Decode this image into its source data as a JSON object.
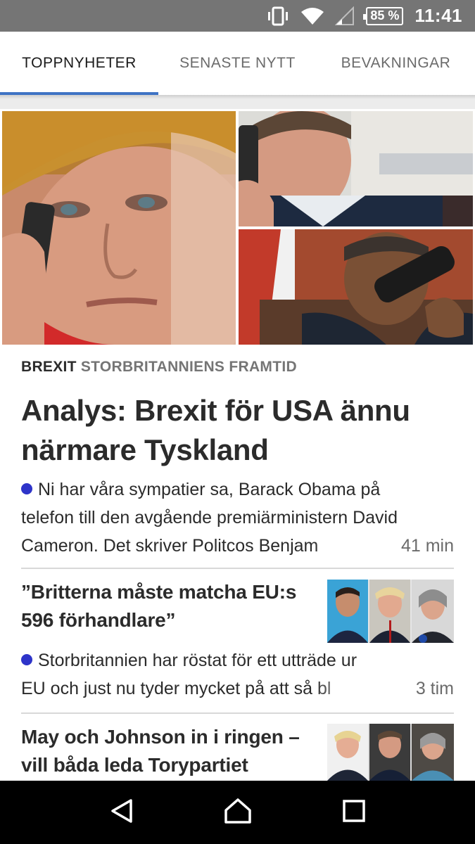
{
  "status_bar": {
    "battery": "85 %",
    "time": "11:41",
    "icons": [
      "vibrate-icon",
      "wifi-icon",
      "signal-icon",
      "battery-icon"
    ]
  },
  "tabs": [
    {
      "label": "TOPPNYHETER",
      "active": true
    },
    {
      "label": "SENASTE NYTT",
      "active": false
    },
    {
      "label": "BEVAKNINGAR",
      "active": false
    }
  ],
  "lead_story": {
    "kicker_primary": "BREXIT",
    "kicker_secondary": "STORBRITANNIENS FRAMTID",
    "headline": "Analys: Brexit för USA ännu närmare Tyskland",
    "lead_line1": "Ni har våra sympatier sa, Barack Obama på",
    "lead_line2": "telefon till den avgående premiärministern David",
    "lead_line3": "Cameron. Det skriver Politcos Benjam",
    "age": "41 min"
  },
  "stories": [
    {
      "headline": "”Britterna måste matcha EU:s 596 förhandlare”",
      "lead_line1": "Storbritannien har röstat för ett utträde ur",
      "lead_line2": "EU och just nu tyder mycket på att så bl",
      "age": "3 tim"
    },
    {
      "headline": "May och Johnson in i ringen – vill båda leda Torypartiet"
    }
  ],
  "colors": {
    "accent_tab": "#3f73c4",
    "bullet": "#2e34c9",
    "status_bar": "#757575",
    "text": "#2b2b2b"
  },
  "nav": {
    "icons": [
      "back-icon",
      "home-icon",
      "recents-icon"
    ]
  }
}
